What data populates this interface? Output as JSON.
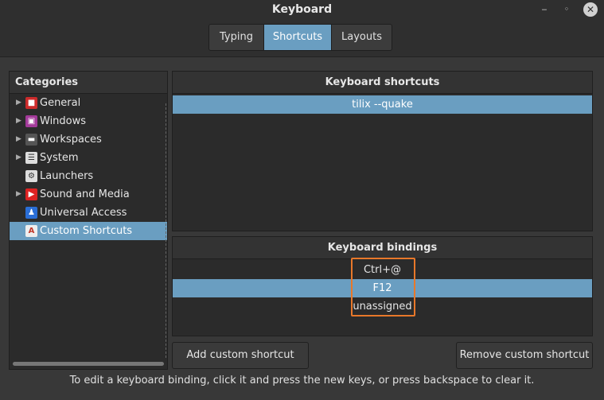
{
  "window": {
    "title": "Keyboard",
    "min_glyph": "‒",
    "max_glyph": "◦",
    "close_glyph": "✕"
  },
  "tabs": [
    {
      "label": "Typing",
      "active": false
    },
    {
      "label": "Shortcuts",
      "active": true
    },
    {
      "label": "Layouts",
      "active": false
    }
  ],
  "categories": {
    "header": "Categories",
    "items": [
      {
        "label": "General",
        "icon": "general-icon",
        "expandable": true,
        "color": "#cc2b2b"
      },
      {
        "label": "Windows",
        "icon": "windows-icon",
        "expandable": true,
        "color": "#a33a9a"
      },
      {
        "label": "Workspaces",
        "icon": "workspaces-icon",
        "expandable": true,
        "color": "#555555"
      },
      {
        "label": "System",
        "icon": "system-icon",
        "expandable": true,
        "color": "#dddddd"
      },
      {
        "label": "Launchers",
        "icon": "launchers-icon",
        "expandable": false,
        "color": "#dddddd"
      },
      {
        "label": "Sound and Media",
        "icon": "sound-media-icon",
        "expandable": true,
        "color": "#dd2222"
      },
      {
        "label": "Universal Access",
        "icon": "universal-access-icon",
        "expandable": false,
        "color": "#2a6ed6"
      },
      {
        "label": "Custom Shortcuts",
        "icon": "custom-shortcuts-icon",
        "expandable": false,
        "color": "#eeeeee",
        "selected": true
      }
    ]
  },
  "shortcuts": {
    "header": "Keyboard shortcuts",
    "items": [
      {
        "label": "tilix --quake",
        "selected": true
      }
    ]
  },
  "bindings": {
    "header": "Keyboard bindings",
    "items": [
      {
        "label": "Ctrl+@",
        "selected": false
      },
      {
        "label": "F12",
        "selected": true
      },
      {
        "label": "unassigned",
        "selected": false
      }
    ]
  },
  "buttons": {
    "add": "Add custom shortcut",
    "remove": "Remove custom shortcut"
  },
  "hint": "To edit a keyboard binding, click it and press the new keys, or press backspace to clear it.",
  "colors": {
    "accent": "#6a9ec1",
    "highlight_box": "#e8782a",
    "background": "#383838"
  }
}
